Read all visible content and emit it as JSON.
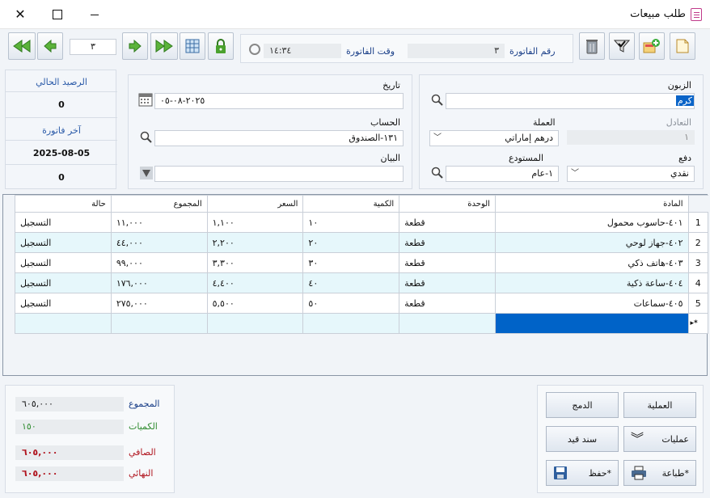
{
  "window": {
    "title": "طلب مبيعات",
    "close": "✕",
    "maximize": "☐"
  },
  "nav": {
    "record_number": "٣"
  },
  "invoice": {
    "number_label": "رقم الفاتورة",
    "number_value": "٣",
    "time_label": "وقت الفاتورة",
    "time_value": "١٤:٣٤"
  },
  "form": {
    "customer_label": "الزبون",
    "customer_value": "كرم",
    "date_label": "تاريخ",
    "date_value": "٢٠٢٥-٠٨-٠٥",
    "rate_label": "التعادل",
    "rate_value": "١",
    "currency_label": "العملة",
    "currency_value": "درهم إماراتي",
    "account_label": "الحساب",
    "account_value": "١٣١-الصندوق",
    "payment_label": "دفع",
    "payment_value": "نقدي",
    "warehouse_label": "المستودع",
    "warehouse_value": "١-عام",
    "statement_label": "البيان",
    "statement_value": ""
  },
  "balance": {
    "current_label": "الرصيد الحالي",
    "current_value": "0",
    "last_invoice_label": "آخر فاتورة",
    "last_invoice_date": "2025-08-05",
    "last_invoice_value": "0"
  },
  "table": {
    "headers": {
      "item": "المادة",
      "unit": "الوحدة",
      "qty": "الكمية",
      "price": "السعر",
      "total": "المجموع",
      "status": "حالة"
    },
    "rows": [
      {
        "n": "1",
        "item": "٤٠١-حاسوب محمول",
        "unit": "قطعة",
        "qty": "١٠",
        "price": "١,١٠٠",
        "total": "١١,٠٠٠",
        "status": "التسجيل"
      },
      {
        "n": "2",
        "item": "٤٠٢-جهاز لوحي",
        "unit": "قطعة",
        "qty": "٢٠",
        "price": "٢,٢٠٠",
        "total": "٤٤,٠٠٠",
        "status": "التسجيل"
      },
      {
        "n": "3",
        "item": "٤٠٣-هاتف ذكي",
        "unit": "قطعة",
        "qty": "٣٠",
        "price": "٣,٣٠٠",
        "total": "٩٩,٠٠٠",
        "status": "التسجيل"
      },
      {
        "n": "4",
        "item": "٤٠٤-ساعة ذكية",
        "unit": "قطعة",
        "qty": "٤٠",
        "price": "٤,٤٠٠",
        "total": "١٧٦,٠٠٠",
        "status": "التسجيل"
      },
      {
        "n": "5",
        "item": "٤٠٥-سماعات",
        "unit": "قطعة",
        "qty": "٥٠",
        "price": "٥,٥٠٠",
        "total": "٢٧٥,٠٠٠",
        "status": "التسجيل"
      }
    ],
    "new_row_marker": "▸*"
  },
  "summary": {
    "total_label": "المجموع",
    "total_value": "٦٠٥,٠٠٠",
    "qty_label": "الكميات",
    "qty_value": "١٥٠",
    "net_label": "الصافي",
    "net_value": "٦٠٥,٠٠٠",
    "final_label": "النهائي",
    "final_value": "٦٠٥,٠٠٠"
  },
  "actions": {
    "operation": "العملية",
    "merge": "الدمج",
    "operations": "عمليات",
    "journal": "سند قيد",
    "print": "طباعة*",
    "save": "حفظ*"
  },
  "colors": {
    "selected_cell": "#0063c8",
    "row_alt": "#e6f7fb",
    "green": "#2e8b2e",
    "red": "#b0141e"
  }
}
